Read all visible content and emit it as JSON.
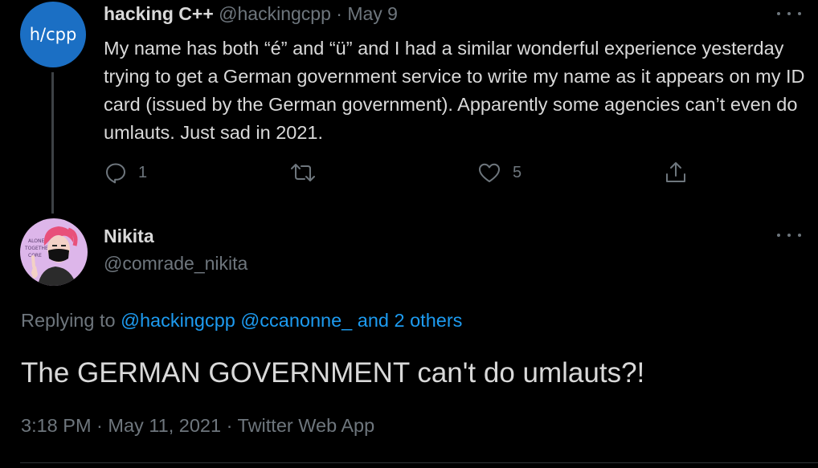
{
  "parent_tweet": {
    "avatar_logo": "h/cpp",
    "display_name": "hacking C++",
    "handle": "@hackingcpp",
    "separator": "·",
    "date": "May 9",
    "text": "My name has both “é” and “ü” and I had a similar wonderful experience yesterday trying to get a German government service to write my name as it appears on my ID card (issued by the German government). Apparently some agencies can’t even do umlauts. Just sad in 2021.",
    "actions": {
      "reply_count": "1",
      "retweet_count": "",
      "like_count": "5"
    },
    "icons": {
      "reply": "reply-icon",
      "retweet": "retweet-icon",
      "like": "heart-icon",
      "share": "share-icon",
      "more": "more-dots-icon"
    }
  },
  "main_tweet": {
    "display_name": "Nikita",
    "handle": "@comrade_nikita",
    "replying_prefix": "Replying to",
    "replying_links": [
      "@hackingcpp",
      "@ccanonne_",
      "and 2 others"
    ],
    "text": "The GERMAN GOVERNMENT can't do umlauts?!",
    "timestamp": "3:18 PM · May 11, 2021 · Twitter Web App",
    "avatar_lettering": "ALONE TOGETHER CORE"
  },
  "colors": {
    "background": "#000000",
    "text_primary": "#d9d9d9",
    "text_secondary": "#6e767d",
    "link": "#1d9bf0",
    "hcpp_avatar": "#1b6fc4",
    "nikita_avatar_bg": "#ddb6ea",
    "nikita_hair": "#e8507a"
  }
}
